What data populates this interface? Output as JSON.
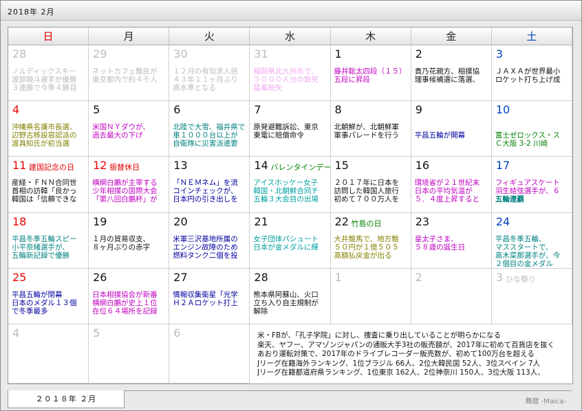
{
  "window": {
    "title": "2018年 2月"
  },
  "headers": [
    "日",
    "月",
    "火",
    "水",
    "木",
    "金",
    "土"
  ],
  "header_colors": [
    "#e00000",
    "#222222",
    "#222222",
    "#222222",
    "#222222",
    "#222222",
    "#0040c0"
  ],
  "cells": [
    {
      "d": "28",
      "c": "gray",
      "lines": [
        {
          "t": "ノルディックスキー",
          "c": "#bbbbbb"
        },
        {
          "t": "渡部暁斗選手が優勝",
          "c": "#bbbbbb"
        },
        {
          "t": "３連勝で今季４勝目",
          "c": "#bbbbbb"
        }
      ]
    },
    {
      "d": "29",
      "c": "gray",
      "lines": [
        {
          "t": "ネットカフェ難民が",
          "c": "#bbbbbb"
        },
        {
          "t": "東京都内で約４千人",
          "c": "#bbbbbb"
        }
      ]
    },
    {
      "d": "30",
      "c": "gray",
      "lines": [
        {
          "t": "１２月の有効求人倍",
          "c": "#bbbbbb"
        },
        {
          "t": "４３年１１ヶ月ぶり",
          "c": "#bbbbbb"
        },
        {
          "t": "高水準となる",
          "c": "#bbbbbb"
        }
      ]
    },
    {
      "d": "31",
      "c": "gray",
      "lines": [
        {
          "t": "福岡県北九州市で、",
          "c": "#f0a8f0"
        },
        {
          "t": "５０００人分の致死",
          "c": "#f0a8f0"
        },
        {
          "t": "猛毒紛失",
          "c": "#f0a8f0"
        }
      ]
    },
    {
      "d": "1",
      "c": "",
      "lines": [
        {
          "t": "藤井聡太四段（１５）",
          "c": "#c000c0"
        },
        {
          "t": "五段に昇段",
          "c": "#c000c0"
        }
      ]
    },
    {
      "d": "2",
      "c": "",
      "lines": [
        {
          "t": "貴乃花親方、相撲協",
          "c": "#111111"
        },
        {
          "t": "理事候補選に落選、",
          "c": "#111111"
        }
      ]
    },
    {
      "d": "3",
      "c": "blue",
      "lines": [
        {
          "t": "ＪＡＸＡが世界最小",
          "c": "#111111"
        },
        {
          "t": "ロケット打ち上げ成",
          "c": "#111111"
        }
      ]
    },
    {
      "d": "4",
      "c": "red",
      "lines": [
        {
          "t": "沖縄県名護市長選、",
          "c": "#808000"
        },
        {
          "t": "辺野古移設容認派の",
          "c": "#808000"
        },
        {
          "t": "渡具知氏が初当選",
          "c": "#808000"
        }
      ]
    },
    {
      "d": "5",
      "c": "",
      "lines": [
        {
          "t": "米国ＮＹダウが、",
          "c": "#c000c0"
        },
        {
          "t": "過去最大の下げ",
          "c": "#c000c0"
        }
      ]
    },
    {
      "d": "6",
      "c": "",
      "lines": [
        {
          "t": "北陸で大雪、福井県で",
          "c": "#008080"
        },
        {
          "t": "車１０００台以上が",
          "c": "#008080"
        },
        {
          "t": "自衛隊に災害派遣要",
          "c": "#008080"
        }
      ]
    },
    {
      "d": "7",
      "c": "",
      "lines": [
        {
          "t": "原発避難訴訟、東京",
          "c": "#111111"
        },
        {
          "t": "東電に賠償命令",
          "c": "#111111"
        }
      ]
    },
    {
      "d": "8",
      "c": "",
      "lines": [
        {
          "t": "北朝鮮が、北朝鮮軍",
          "c": "#111111"
        },
        {
          "t": "軍事パレードを行う",
          "c": "#111111"
        }
      ]
    },
    {
      "d": "9",
      "c": "",
      "lines": [
        {
          "t": "",
          "c": "#111111"
        },
        {
          "t": "平昌五輪が開幕",
          "c": "#0000a0"
        }
      ]
    },
    {
      "d": "10",
      "c": "blue",
      "lines": [
        {
          "t": "",
          "c": "#111111"
        },
        {
          "t": "富士ゼロックス・ス",
          "c": "#008000"
        },
        {
          "t": "Ｃ大阪 3-2 川崎",
          "c": "#008000"
        }
      ]
    },
    {
      "d": "11",
      "c": "red",
      "hol": "建国記念の日",
      "hc": "#e00000",
      "lines": [
        {
          "t": "産経・ＦＮＮ合同世",
          "c": "#111111"
        },
        {
          "t": "首相の訪韓「良かっ",
          "c": "#111111"
        },
        {
          "t": "韓国は「信頼できな",
          "c": "#111111"
        }
      ]
    },
    {
      "d": "12",
      "c": "red",
      "hol": "振替休日",
      "hc": "#e00000",
      "lines": [
        {
          "t": "横綱白鵬が主宰する",
          "c": "#c000c0"
        },
        {
          "t": "少年相撲の国際大会",
          "c": "#c000c0"
        },
        {
          "t": "「第八回白鵬杯」が",
          "c": "#c000c0"
        }
      ]
    },
    {
      "d": "13",
      "c": "",
      "lines": [
        {
          "t": "「ＮＥＭネム」を流",
          "c": "#0000a0"
        },
        {
          "t": "コインチェックが、",
          "c": "#0000a0"
        },
        {
          "t": "日本円の引き出しを",
          "c": "#0000a0"
        }
      ]
    },
    {
      "d": "14",
      "c": "",
      "hol": "バレンタインデー",
      "hc": "#008000",
      "lines": [
        {
          "t": "アイスホッケー女子",
          "c": "#00a0a0"
        },
        {
          "t": "韓国・北朝鮮合同チ",
          "c": "#00a0a0"
        },
        {
          "t": "五輪３大会目の出場",
          "c": "#00a0a0"
        }
      ]
    },
    {
      "d": "15",
      "c": "",
      "lines": [
        {
          "t": "２０１７年に日本を",
          "c": "#111111"
        },
        {
          "t": "訪問した韓国人旅行",
          "c": "#111111"
        },
        {
          "t": "初めて７００万人を",
          "c": "#111111"
        }
      ]
    },
    {
      "d": "16",
      "c": "",
      "lines": [
        {
          "t": "環境省が２１世紀末",
          "c": "#c000c0"
        },
        {
          "t": "日本の平均気温が",
          "c": "#c000c0"
        },
        {
          "t": "５．４度上昇すると",
          "c": "#c000c0"
        }
      ]
    },
    {
      "d": "17",
      "c": "blue",
      "lines": [
        {
          "t": "フィギュアスケート",
          "c": "#c000c0"
        },
        {
          "t": "羽生結弦選手が、６",
          "c": "#c000c0"
        },
        {
          "t": "五輪連覇",
          "c": "#008080",
          "b": true
        }
      ]
    },
    {
      "d": "18",
      "c": "red",
      "lines": [
        {
          "t": "平昌冬季五輪スピー",
          "c": "#008080"
        },
        {
          "t": "小平奈緒選手が、",
          "c": "#008080"
        },
        {
          "t": "五輪新記録で優勝",
          "c": "#008080"
        }
      ]
    },
    {
      "d": "19",
      "c": "",
      "lines": [
        {
          "t": "１月の貿易収支、",
          "c": "#111111"
        },
        {
          "t": "８ヶ月ぶりの赤字",
          "c": "#111111"
        }
      ]
    },
    {
      "d": "20",
      "c": "",
      "lines": [
        {
          "t": "米軍三沢基地所属の",
          "c": "#0000a0"
        },
        {
          "t": "エンジン故障のため",
          "c": "#0000a0"
        },
        {
          "t": "燃料タンク二個を投",
          "c": "#0000a0"
        }
      ]
    },
    {
      "d": "21",
      "c": "",
      "lines": [
        {
          "t": "女子団体パシュート",
          "c": "#00a0a0"
        },
        {
          "t": "日本が金メダルに輝",
          "c": "#00a0a0"
        }
      ]
    },
    {
      "d": "22",
      "c": "",
      "hol": "竹島の日",
      "hc": "#008000",
      "lines": [
        {
          "t": "大井競馬で、地方競",
          "c": "#808000"
        },
        {
          "t": "５０円が１億５０５",
          "c": "#808000"
        },
        {
          "t": "高額払戻金が出る",
          "c": "#808000"
        }
      ]
    },
    {
      "d": "23",
      "c": "",
      "lines": [
        {
          "t": "皇太子さま、",
          "c": "#c000c0"
        },
        {
          "t": "５８歳の誕生日",
          "c": "#c000c0"
        }
      ]
    },
    {
      "d": "24",
      "c": "blue",
      "lines": [
        {
          "t": "平昌冬季五輪、",
          "c": "#008080"
        },
        {
          "t": "マススタートで、",
          "c": "#008080"
        },
        {
          "t": "高木菜那選手が、今",
          "c": "#008080"
        },
        {
          "t": "２個目の金メダル",
          "c": "#008080"
        }
      ]
    },
    {
      "d": "25",
      "c": "red",
      "lines": [
        {
          "t": "平昌五輪が閉幕",
          "c": "#0000a0"
        },
        {
          "t": "日本のメダル１３個",
          "c": "#0000a0"
        },
        {
          "t": "で冬季最多",
          "c": "#0000a0"
        }
      ]
    },
    {
      "d": "26",
      "c": "",
      "lines": [
        {
          "t": "日本相撲協会が新番",
          "c": "#c000c0"
        },
        {
          "t": "横綱白鵬が史上１位",
          "c": "#c000c0"
        },
        {
          "t": "在位６４場所を記録",
          "c": "#c000c0"
        }
      ]
    },
    {
      "d": "27",
      "c": "",
      "lines": [
        {
          "t": "情報収集衛星「光学",
          "c": "#0000a0"
        },
        {
          "t": "Ｈ２Ａロケット打上",
          "c": "#0000a0"
        }
      ]
    },
    {
      "d": "28",
      "c": "",
      "lines": [
        {
          "t": "熊本県阿蘇山、火口",
          "c": "#111111"
        },
        {
          "t": "立ち入り自主規制が",
          "c": "#111111"
        },
        {
          "t": "解除",
          "c": "#111111"
        }
      ]
    },
    {
      "d": "1",
      "c": "gray",
      "lines": []
    },
    {
      "d": "2",
      "c": "gray",
      "lines": []
    },
    {
      "d": "3",
      "c": "gray",
      "hol": "ひな祭り",
      "hc": "#bbbbbb",
      "lines": []
    },
    {
      "d": "4",
      "c": "gray",
      "lines": []
    },
    {
      "d": "5",
      "c": "gray",
      "lines": []
    },
    {
      "d": "6",
      "c": "gray",
      "lines": []
    }
  ],
  "notes": [
    "米・FBが、「孔子学院」に対し、捜査に乗り出していることが明らかになる",
    "楽天、ヤフー、アマゾンジャパンの通販大手3社の販売額が、2017年に初めて百貨店を抜く",
    "あおり運転対策で、2017年のドライブレコーダー販売数が、初めて100万台を超える",
    "Jリーグ在籍海外ランキング、1位ブラジル 66人、2位大韓民国 52人、3位スペイン 7人",
    "Jリーグ在籍都道府県ランキング、1位東京 162人、2位神奈川 150人、3位大阪 113人、"
  ],
  "bottom": {
    "tab_label": "２０１８年 ２月",
    "app_name": "舞暦 -Maica-"
  }
}
